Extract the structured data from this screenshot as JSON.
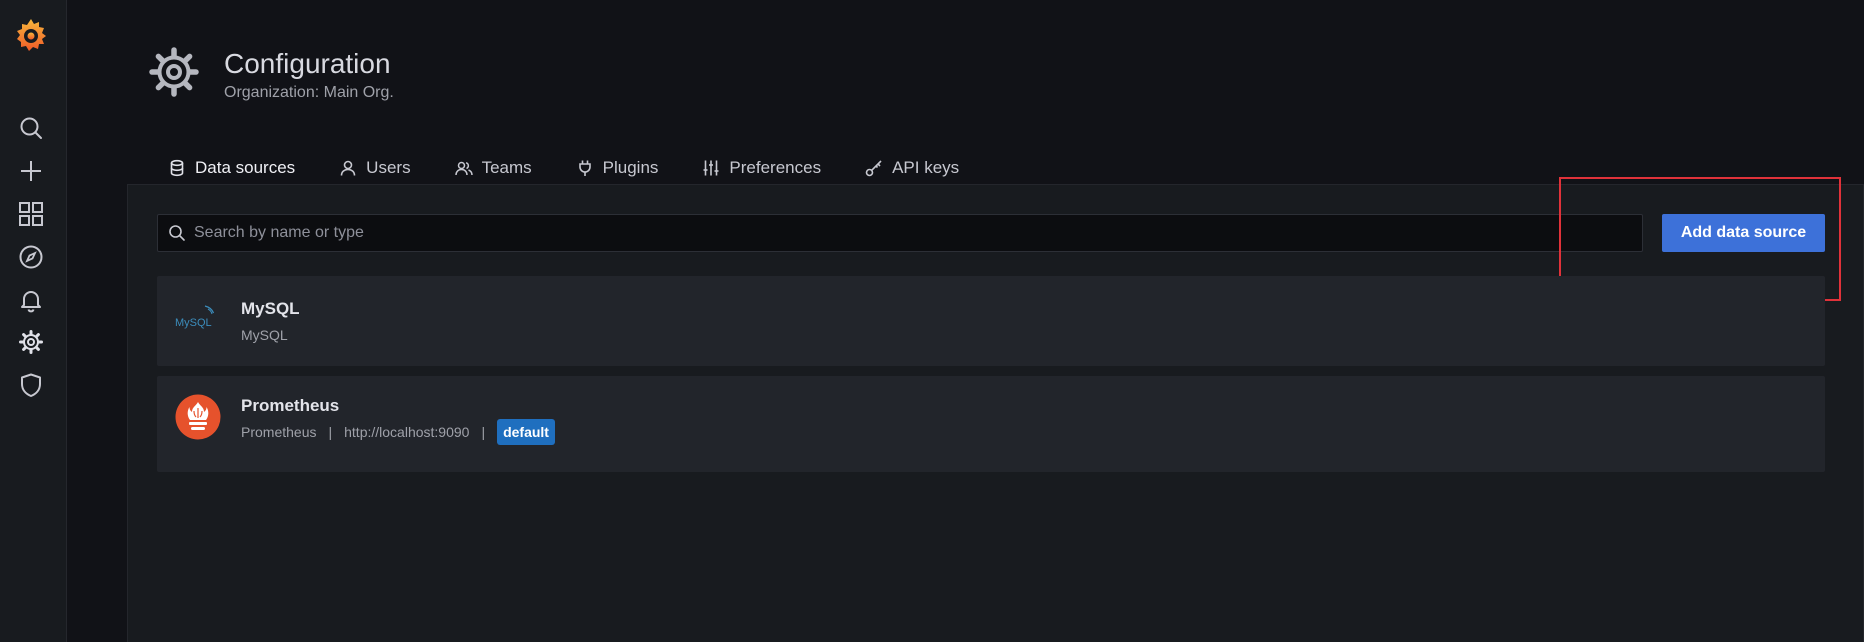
{
  "colors": {
    "background": "#111217",
    "sidebar": "#181b1f",
    "panel": "#181b1f",
    "card": "#22252b",
    "primary_button": "#3d71d9",
    "active_tab_underline": "#f55f3e",
    "default_badge": "#1f6fbf",
    "highlight_outline": "#e0323a"
  },
  "sidebar": {
    "logo_icon": "grafana-logo-icon",
    "items": [
      {
        "icon": "search-icon"
      },
      {
        "icon": "plus-icon"
      },
      {
        "icon": "dashboards-grid-icon"
      },
      {
        "icon": "compass-icon"
      },
      {
        "icon": "bell-icon"
      },
      {
        "icon": "gear-icon",
        "active": true
      },
      {
        "icon": "shield-icon"
      }
    ]
  },
  "header": {
    "icon": "gear-icon",
    "title": "Configuration",
    "subtitle": "Organization: Main Org."
  },
  "tabs": [
    {
      "label": "Data sources",
      "icon": "database-icon",
      "active": true
    },
    {
      "label": "Users",
      "icon": "user-icon"
    },
    {
      "label": "Teams",
      "icon": "users-icon"
    },
    {
      "label": "Plugins",
      "icon": "plug-icon"
    },
    {
      "label": "Preferences",
      "icon": "sliders-icon"
    },
    {
      "label": "API keys",
      "icon": "key-icon"
    }
  ],
  "search": {
    "placeholder": "Search by name or type",
    "value": ""
  },
  "add_button_label": "Add data source",
  "datasources": [
    {
      "name": "MySQL",
      "type": "MySQL",
      "logo": "mysql-logo-icon",
      "logo_text": "MySQL"
    },
    {
      "name": "Prometheus",
      "type": "Prometheus",
      "url": "http://localhost:9090",
      "separator": "|",
      "badge": "default",
      "logo": "prometheus-logo-icon"
    }
  ]
}
